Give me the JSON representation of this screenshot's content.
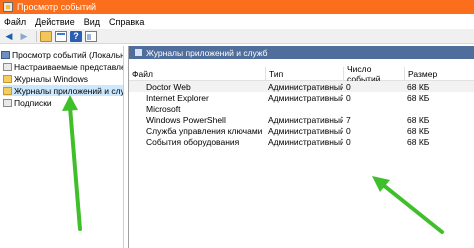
{
  "window": {
    "title": "Просмотр событий"
  },
  "menu": [
    "Файл",
    "Действие",
    "Вид",
    "Справка"
  ],
  "toolbar": {
    "back": "◀",
    "forward": "▶",
    "help": "?"
  },
  "tree": {
    "root": "Просмотр событий (Локальный)",
    "custom_views": "Настраиваемые представления",
    "windows_logs": "Журналы Windows",
    "app_service_logs": "Журналы приложений и служб",
    "subscriptions": "Подписки"
  },
  "pane": {
    "header": "Журналы приложений и служб"
  },
  "table": {
    "columns": [
      "Файл",
      "Тип",
      "Число событий",
      "Размер"
    ],
    "rows": [
      [
        "Doctor Web",
        "Административный",
        "0",
        "68 КБ"
      ],
      [
        "Internet Explorer",
        "Административный",
        "0",
        "68 КБ"
      ],
      [
        "Microsoft",
        "",
        "",
        ""
      ],
      [
        "Windows PowerShell",
        "Административный",
        "7",
        "68 КБ"
      ],
      [
        "Служба управления ключами",
        "Административный",
        "0",
        "68 КБ"
      ],
      [
        "События оборудования",
        "Административный",
        "0",
        "68 КБ"
      ]
    ]
  },
  "colors": {
    "titlebar": "#fb6f1c",
    "pane_header": "#4f6e9b",
    "tree_selection": "#cce8ff",
    "annotation_arrow": "#3fbf2a"
  }
}
